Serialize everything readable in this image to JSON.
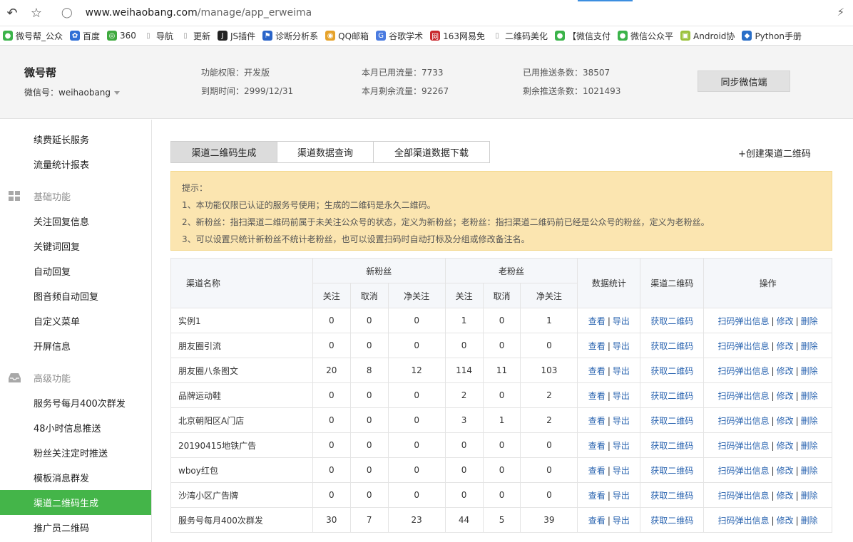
{
  "browser": {
    "url_host": "www.weihaobang.com",
    "url_path": "/manage/app_erweima",
    "bookmarks": [
      {
        "label": "微号帮_公众",
        "icon": "wechat-icon",
        "color": "#3bb34a"
      },
      {
        "label": "百度",
        "icon": "baidu-paw-icon",
        "color": "#2f6fd6"
      },
      {
        "label": "360",
        "icon": "360-icon",
        "color": "#3faa3f"
      },
      {
        "label": "导航",
        "icon": "page-icon",
        "color": "#bbbbbb"
      },
      {
        "label": "更新",
        "icon": "page-icon",
        "color": "#bbbbbb"
      },
      {
        "label": "JS插件",
        "icon": "js-icon",
        "color": "#222222"
      },
      {
        "label": "诊断分析系",
        "icon": "flag-icon",
        "color": "#2a64c8"
      },
      {
        "label": "QQ邮箱",
        "icon": "chrome-icon",
        "color": "#e6a22a"
      },
      {
        "label": "谷歌学术",
        "icon": "google-icon",
        "color": "#4a7be0"
      },
      {
        "label": "163网易免",
        "icon": "163-icon",
        "color": "#c8282d"
      },
      {
        "label": "二维码美化",
        "icon": "page-icon",
        "color": "#bbbbbb"
      },
      {
        "label": "【微信支付",
        "icon": "wechat-icon",
        "color": "#3bb34a"
      },
      {
        "label": "微信公众平",
        "icon": "wechat-icon",
        "color": "#3bb34a"
      },
      {
        "label": "Android协",
        "icon": "android-icon",
        "color": "#9bc13c"
      },
      {
        "label": "Python手册",
        "icon": "python-icon",
        "color": "#2a6fc8"
      }
    ]
  },
  "header": {
    "brand_name": "微号帮",
    "wechat_id": "微信号：weihaobang",
    "permission": "功能权限：开发版",
    "expire": "到期时间：2999/12/31",
    "traffic_used": "本月已用流量：7733",
    "traffic_left": "本月剩余流量：92267",
    "push_used": "已用推送条数：38507",
    "push_left": "剩余推送条数：1021493",
    "sync_button": "同步微信端"
  },
  "sidebar": {
    "item_renew": "续费延长服务",
    "item_traffic": "流量统计报表",
    "group_basic": "基础功能",
    "item_follow_reply": "关注回复信息",
    "item_keyword": "关键词回复",
    "item_auto_reply": "自动回复",
    "item_media_reply": "图音频自动回复",
    "item_custom_menu": "自定义菜单",
    "item_splash": "开屏信息",
    "group_advanced": "高级功能",
    "item_mass_400": "服务号每月400次群发",
    "item_48h": "48小时信息推送",
    "item_timed_push": "粉丝关注定时推送",
    "item_template": "模板消息群发",
    "item_channel_qr": "渠道二维码生成",
    "item_promoter_qr": "推广员二维码"
  },
  "main": {
    "tab_generate": "渠道二维码生成",
    "tab_query": "渠道数据查询",
    "tab_download": "全部渠道数据下载",
    "create_link": "+创建渠道二维码",
    "notice_title": "提示：",
    "notice_1": "1、本功能仅限已认证的服务号使用；生成的二维码是永久二维码。",
    "notice_2": "2、新粉丝：指扫渠道二维码前属于未关注公众号的状态，定义为新粉丝；老粉丝：指扫渠道二维码前已经是公众号的粉丝，定义为老粉丝。",
    "notice_3": "3、可以设置只统计新粉丝不统计老粉丝，也可以设置扫码时自动打标及分组或修改备注名。"
  },
  "table": {
    "h_name": "渠道名称",
    "h_new_fans": "新粉丝",
    "h_old_fans": "老粉丝",
    "h_stats": "数据统计",
    "h_qr": "渠道二维码",
    "h_ops": "操作",
    "h_follow": "关注",
    "h_cancel": "取消",
    "h_net": "净关注",
    "link_view": "查看",
    "link_export": "导出",
    "link_getqr": "获取二维码",
    "link_popup": "扫码弹出信息",
    "link_edit": "修改",
    "link_delete": "删除",
    "rows": [
      {
        "name": "实例1",
        "nf": "0",
        "nc": "0",
        "nn": "0",
        "of": "1",
        "oc": "0",
        "on": "1"
      },
      {
        "name": "朋友圈引流",
        "nf": "0",
        "nc": "0",
        "nn": "0",
        "of": "0",
        "oc": "0",
        "on": "0"
      },
      {
        "name": "朋友圈八条图文",
        "nf": "20",
        "nc": "8",
        "nn": "12",
        "of": "114",
        "oc": "11",
        "on": "103"
      },
      {
        "name": "品牌运动鞋",
        "nf": "0",
        "nc": "0",
        "nn": "0",
        "of": "2",
        "oc": "0",
        "on": "2"
      },
      {
        "name": "北京朝阳区A门店",
        "nf": "0",
        "nc": "0",
        "nn": "0",
        "of": "3",
        "oc": "1",
        "on": "2"
      },
      {
        "name": "20190415地铁广告",
        "nf": "0",
        "nc": "0",
        "nn": "0",
        "of": "0",
        "oc": "0",
        "on": "0"
      },
      {
        "name": "wboy红包",
        "nf": "0",
        "nc": "0",
        "nn": "0",
        "of": "0",
        "oc": "0",
        "on": "0"
      },
      {
        "name": "沙湾小区广告牌",
        "nf": "0",
        "nc": "0",
        "nn": "0",
        "of": "0",
        "oc": "0",
        "on": "0"
      },
      {
        "name": "服务号每月400次群发",
        "nf": "30",
        "nc": "7",
        "nn": "23",
        "of": "44",
        "oc": "5",
        "on": "39"
      }
    ]
  }
}
